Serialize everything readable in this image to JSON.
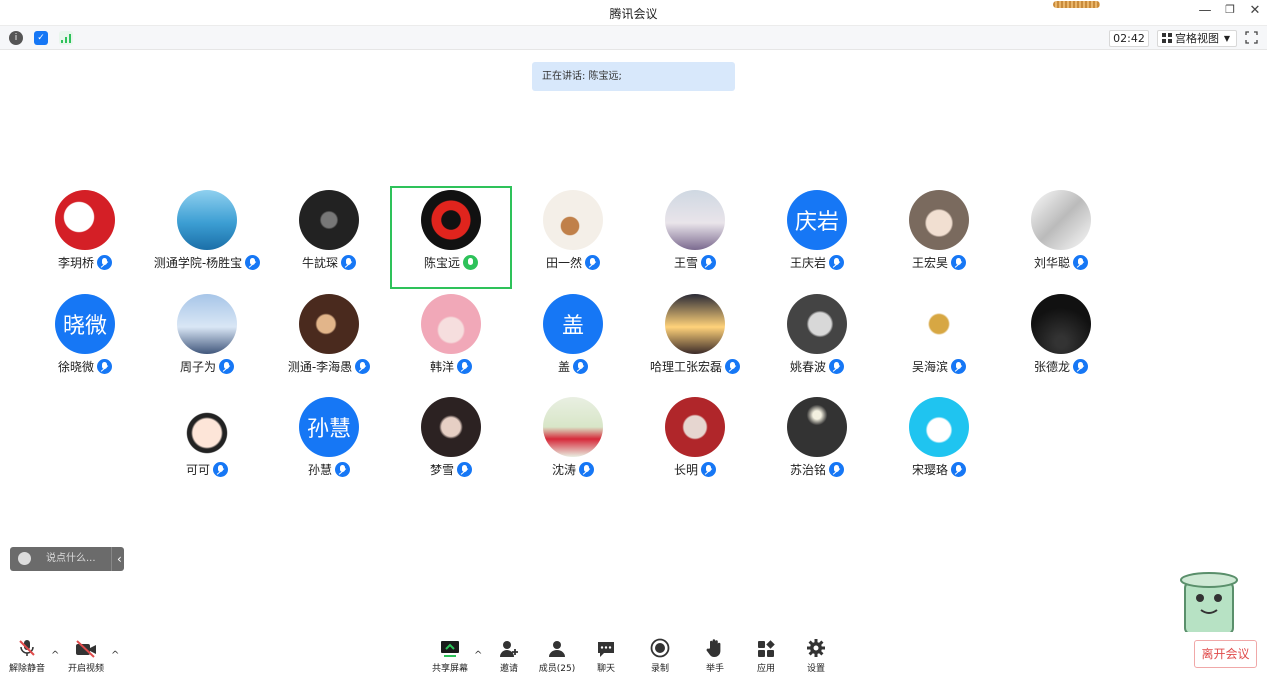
{
  "window": {
    "title": "腾讯会议"
  },
  "toolbar": {
    "timer": "02:42",
    "view_label": "宫格视图"
  },
  "speaking": "正在讲话: 陈宝远;",
  "participants": [
    {
      "name": "李玥桥",
      "avatar": "red-logo",
      "mic": "blue"
    },
    {
      "name": "测通学院-杨胜宝",
      "avatar": "lake-photo",
      "mic": "blue"
    },
    {
      "name": "牛訦琛",
      "avatar": "batman-logo",
      "mic": "blue"
    },
    {
      "name": "陈宝远",
      "avatar": "red-emblem",
      "mic": "green",
      "active": true
    },
    {
      "name": "田一然",
      "avatar": "dog-photo",
      "mic": "blue"
    },
    {
      "name": "王雪",
      "avatar": "person-photo",
      "mic": "blue"
    },
    {
      "name": "王庆岩",
      "avatar_text": "庆岩",
      "mic": "blue"
    },
    {
      "name": "王宏昊",
      "avatar": "anime-photo",
      "mic": "blue"
    },
    {
      "name": "刘华聪",
      "avatar": "comic-photo",
      "mic": "blue"
    },
    {
      "name": "徐晓微",
      "avatar_text": "晓微",
      "mic": "blue"
    },
    {
      "name": "周子为",
      "avatar": "snow-photo",
      "mic": "blue"
    },
    {
      "name": "测通-李海愚",
      "avatar": "musician-photo",
      "mic": "blue"
    },
    {
      "name": "韩洋",
      "avatar": "anime-girl",
      "mic": "blue"
    },
    {
      "name": "盖",
      "avatar_text": "盖",
      "mic": "blue"
    },
    {
      "name": "哈理工张宏磊",
      "avatar": "sunset-photo",
      "mic": "blue"
    },
    {
      "name": "姚春波",
      "avatar": "bw-face",
      "mic": "blue"
    },
    {
      "name": "吴海滨",
      "avatar": "horn-emblem",
      "mic": "blue"
    },
    {
      "name": "张德龙",
      "avatar": "night-sky",
      "mic": "blue"
    },
    {
      "name": "可可",
      "avatar": "cartoon-girl",
      "mic": "blue"
    },
    {
      "name": "孙慧",
      "avatar_text": "孙慧",
      "mic": "blue"
    },
    {
      "name": "梦雪",
      "avatar": "girl-photo",
      "mic": "blue"
    },
    {
      "name": "沈涛",
      "avatar": "red-coat-photo",
      "mic": "blue"
    },
    {
      "name": "长明",
      "avatar": "painting-photo",
      "mic": "blue"
    },
    {
      "name": "苏治铭",
      "avatar": "dark-photo",
      "mic": "blue"
    },
    {
      "name": "宋璎珞",
      "avatar": "rabbit-cartoon",
      "mic": "blue"
    }
  ],
  "chat": {
    "placeholder": "说点什么..."
  },
  "bottom": {
    "unmute": "解除静音",
    "start_video": "开启视频",
    "share_screen": "共享屏幕",
    "invite": "邀请",
    "members": "成员(25)",
    "chat": "聊天",
    "record": "录制",
    "raise_hand": "举手",
    "apps": "应用",
    "settings": "设置",
    "leave": "离开会议"
  },
  "colors": {
    "accent": "#1677f5",
    "active_border": "#2ec25a",
    "leave": "#e04b4b"
  }
}
